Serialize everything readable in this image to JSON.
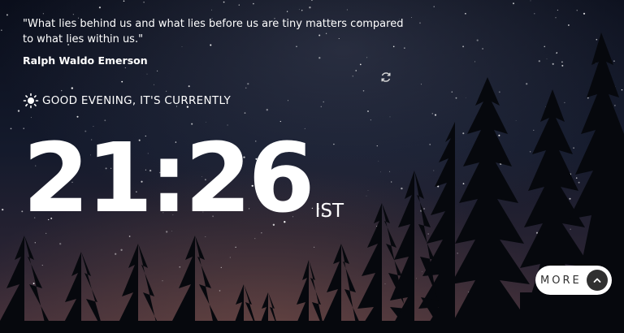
{
  "quote": {
    "text": "\"What lies behind us and what lies before us are tiny matters compared to what lies within us.\"",
    "author": "Ralph Waldo Emerson",
    "refresh_icon": "refresh-icon"
  },
  "greeting": {
    "icon": "sun-icon",
    "text": "GOOD EVENING, IT'S CURRENTLY"
  },
  "clock": {
    "time": "21:26",
    "timezone": "IST"
  },
  "more_button": {
    "label": "MORE",
    "icon": "chevron-up-icon"
  },
  "colors": {
    "text": "#ffffff",
    "button_bg": "#ffffff",
    "button_text": "#303030",
    "sky_top": "#0b0f1c",
    "sky_bottom": "#3a2b38"
  }
}
